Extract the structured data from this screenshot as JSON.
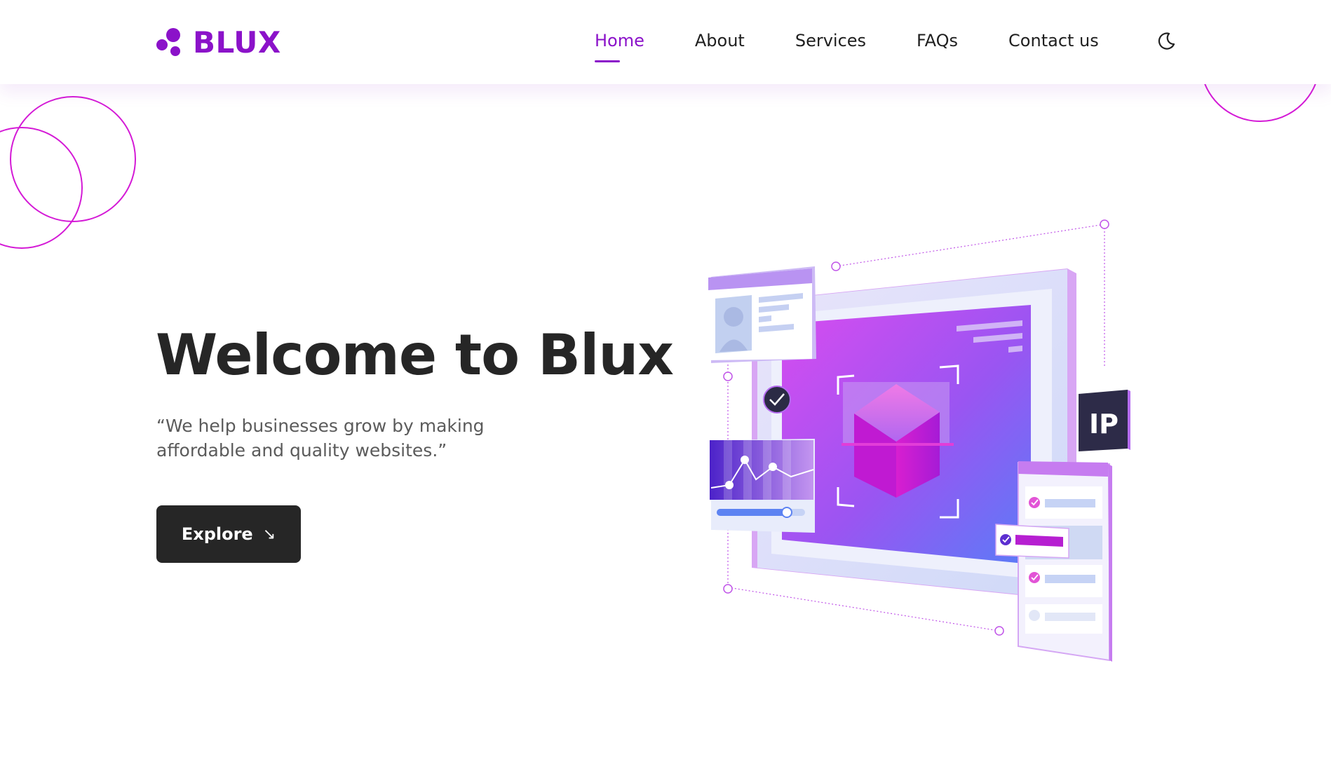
{
  "brand": {
    "name": "BLUX",
    "color": "#8b12c9"
  },
  "nav": {
    "items": [
      {
        "label": "Home",
        "active": true
      },
      {
        "label": "About",
        "active": false
      },
      {
        "label": "Services",
        "active": false
      },
      {
        "label": "FAQs",
        "active": false
      },
      {
        "label": "Contact us",
        "active": false
      }
    ],
    "theme_toggle_icon": "moon-icon"
  },
  "hero": {
    "title": "Welcome to Blux",
    "subtitle": "“We help businesses grow by making affordable and quality websites.”",
    "cta_label": "Explore",
    "cta_icon": "arrow-down-right-icon"
  },
  "illustration": {
    "badge_text": "IP",
    "icons": [
      "profile-card-icon",
      "check-icon",
      "chart-card-icon",
      "cube-icon",
      "checklist-card-icon"
    ]
  },
  "colors": {
    "accent": "#8b12c9",
    "text_dark": "#262626",
    "text_muted": "#5b5b5b",
    "decor_line": "#d41ad6"
  }
}
